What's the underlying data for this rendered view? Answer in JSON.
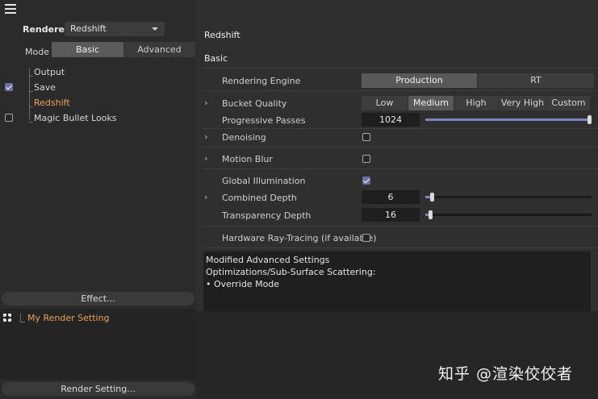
{
  "renderer": {
    "label": "Renderer",
    "value": "Redshift"
  },
  "mode": {
    "label": "Mode",
    "options": [
      "Basic",
      "Advanced"
    ],
    "selected": "Basic"
  },
  "tree": [
    {
      "label": "Output",
      "checked": null,
      "active": false
    },
    {
      "label": "Save",
      "checked": true,
      "active": false
    },
    {
      "label": "Redshift",
      "checked": null,
      "active": true
    },
    {
      "label": "Magic Bullet Looks",
      "checked": false,
      "active": false
    }
  ],
  "effect_button": "Effect...",
  "render_settings": [
    {
      "label": "My Render Setting"
    }
  ],
  "render_setting_button": "Render Setting...",
  "panel": {
    "title": "Redshift",
    "section": "Basic",
    "rendering_engine": {
      "label": "Rendering Engine",
      "options": [
        "Production",
        "RT"
      ],
      "selected": "Production"
    },
    "bucket_quality": {
      "label": "Bucket Quality",
      "options": [
        "Low",
        "Medium",
        "High",
        "Very High",
        "Custom"
      ],
      "selected": "Medium"
    },
    "progressive_passes": {
      "label": "Progressive Passes",
      "value": "1024",
      "fraction": 1.0
    },
    "denoising": {
      "label": "Denoising",
      "checked": false
    },
    "motion_blur": {
      "label": "Motion Blur",
      "checked": false
    },
    "global_illumination": {
      "label": "Global Illumination",
      "checked": true
    },
    "combined_depth": {
      "label": "Combined Depth",
      "value": "6",
      "fraction": 0.03
    },
    "transparency_depth": {
      "label": "Transparency Depth",
      "value": "16",
      "fraction": 0.02
    },
    "hardware_rt": {
      "label": "Hardware Ray-Tracing (if available)",
      "checked": false
    }
  },
  "info": {
    "line1": "Modified Advanced Settings",
    "line2": "Optimizations/Sub-Surface Scattering:",
    "line3": "• Override Mode"
  },
  "watermark": "知乎 @渲染佼佼者",
  "colors": {
    "accent": "#7c80c0",
    "active_text": "#f0a050",
    "check_fill": "#6e70a8"
  }
}
